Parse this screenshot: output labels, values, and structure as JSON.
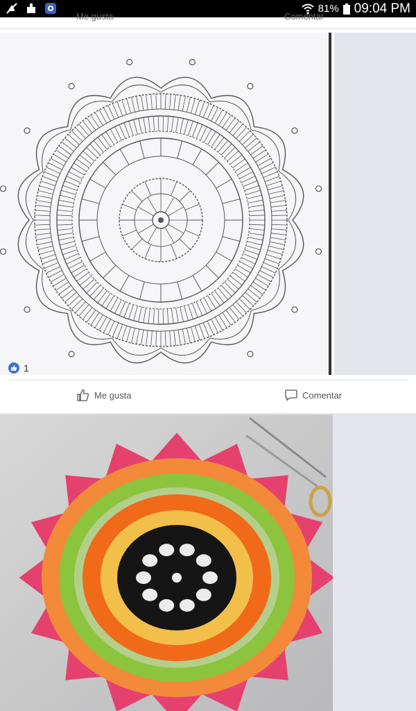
{
  "status_bar": {
    "battery": "81%",
    "time": "09:04 PM",
    "icons": [
      "mute-icon",
      "cleaner-icon",
      "app-icon",
      "wifi-icon",
      "battery-icon"
    ]
  },
  "post1": {
    "clipped_like_label": "Me gusta",
    "clipped_comment_label": "Comentar",
    "image_icon": "crochet-diagram",
    "reaction_count": "1",
    "like_label": "Me gusta",
    "comment_label": "Comentar"
  },
  "post2": {
    "image_icon": "crochet-doily-photo"
  },
  "colors": {
    "brand_blue": "#3b6fd0",
    "statusbar_bg": "#000000",
    "feed_bg": "#e4e6eb",
    "doily_orange": "#f06a1a",
    "doily_green": "#8cc43d",
    "doily_pink": "#e5416e",
    "doily_yellow": "#f2c04a",
    "doily_black": "#151515"
  }
}
